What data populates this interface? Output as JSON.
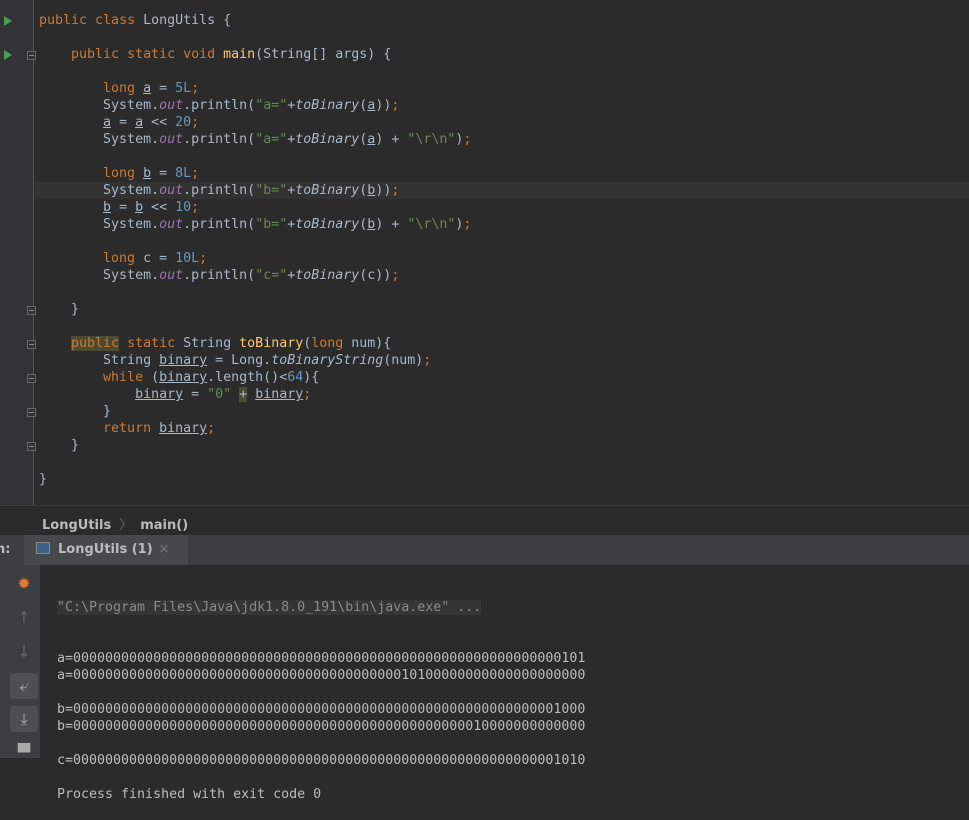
{
  "editor": {
    "current_line": 10,
    "lines": [
      [
        [
          "public ",
          "kw"
        ],
        [
          "class ",
          "kw"
        ],
        [
          "LongUtils {",
          ""
        ]
      ],
      [],
      [
        [
          "    public ",
          "kw"
        ],
        [
          "static ",
          "kw"
        ],
        [
          "void ",
          "kw"
        ],
        [
          "main",
          "fn"
        ],
        [
          "(String[] args) {",
          ""
        ]
      ],
      [],
      [
        [
          "        long ",
          "kw"
        ],
        [
          "a",
          "var"
        ],
        [
          " = ",
          ""
        ],
        [
          "5L",
          "num"
        ],
        [
          ";",
          "kw"
        ]
      ],
      [
        [
          "        System.",
          ""
        ],
        [
          "out",
          "fld"
        ],
        [
          ".println(",
          ""
        ],
        [
          "\"a=\"",
          "str"
        ],
        [
          "+",
          ""
        ],
        [
          "toBinary",
          "sm"
        ],
        [
          "(",
          ""
        ],
        [
          "a",
          "var"
        ],
        [
          "))",
          ""
        ],
        [
          ";",
          "kw"
        ]
      ],
      [
        [
          "        ",
          ""
        ],
        [
          "a",
          "var"
        ],
        [
          " = ",
          ""
        ],
        [
          "a",
          "var"
        ],
        [
          " << ",
          ""
        ],
        [
          "20",
          "num"
        ],
        [
          ";",
          "kw"
        ]
      ],
      [
        [
          "        System.",
          ""
        ],
        [
          "out",
          "fld"
        ],
        [
          ".println(",
          ""
        ],
        [
          "\"a=\"",
          "str"
        ],
        [
          "+",
          ""
        ],
        [
          "toBinary",
          "sm"
        ],
        [
          "(",
          ""
        ],
        [
          "a",
          "var"
        ],
        [
          ") + ",
          ""
        ],
        [
          "\"\\r\\n\"",
          "str"
        ],
        [
          ")",
          ""
        ],
        [
          ";",
          "kw"
        ]
      ],
      [],
      [
        [
          "        long ",
          "kw"
        ],
        [
          "b",
          "var"
        ],
        [
          " = ",
          ""
        ],
        [
          "8L",
          "num"
        ],
        [
          ";",
          "kw"
        ]
      ],
      [
        [
          "        System.",
          ""
        ],
        [
          "out",
          "fld"
        ],
        [
          ".println(",
          ""
        ],
        [
          "\"b=\"",
          "str"
        ],
        [
          "+",
          ""
        ],
        [
          "toBinary",
          "sm"
        ],
        [
          "(",
          ""
        ],
        [
          "b",
          "var"
        ],
        [
          "))",
          ""
        ],
        [
          ";",
          "kw"
        ]
      ],
      [
        [
          "        ",
          ""
        ],
        [
          "b",
          "var"
        ],
        [
          " = ",
          ""
        ],
        [
          "b",
          "var"
        ],
        [
          " << ",
          ""
        ],
        [
          "10",
          "num"
        ],
        [
          ";",
          "kw"
        ]
      ],
      [
        [
          "        System.",
          ""
        ],
        [
          "out",
          "fld"
        ],
        [
          ".println(",
          ""
        ],
        [
          "\"b=\"",
          "str"
        ],
        [
          "+",
          ""
        ],
        [
          "toBinary",
          "sm"
        ],
        [
          "(",
          ""
        ],
        [
          "b",
          "var"
        ],
        [
          ") + ",
          ""
        ],
        [
          "\"\\r\\n\"",
          "str"
        ],
        [
          ")",
          ""
        ],
        [
          ";",
          "kw"
        ]
      ],
      [],
      [
        [
          "        long ",
          "kw"
        ],
        [
          "c = ",
          ""
        ],
        [
          "10L",
          "num"
        ],
        [
          ";",
          "kw"
        ]
      ],
      [
        [
          "        System.",
          ""
        ],
        [
          "out",
          "fld"
        ],
        [
          ".println(",
          ""
        ],
        [
          "\"c=\"",
          "str"
        ],
        [
          "+",
          ""
        ],
        [
          "toBinary",
          "sm"
        ],
        [
          "(c))",
          ""
        ],
        [
          ";",
          "kw"
        ]
      ],
      [],
      [
        [
          "    }",
          ""
        ]
      ],
      [],
      [
        [
          "    ",
          ""
        ],
        [
          "public",
          "kw hl"
        ],
        [
          " static ",
          "kw"
        ],
        [
          "String ",
          ""
        ],
        [
          "toBinary",
          "fn"
        ],
        [
          "(",
          ""
        ],
        [
          "long ",
          "kw"
        ],
        [
          "num){",
          ""
        ]
      ],
      [
        [
          "        String ",
          ""
        ],
        [
          "binary",
          "var"
        ],
        [
          " = Long.",
          ""
        ],
        [
          "toBinaryString",
          "sm"
        ],
        [
          "(num)",
          ""
        ],
        [
          ";",
          "kw"
        ]
      ],
      [
        [
          "        while ",
          "kw"
        ],
        [
          "(",
          ""
        ],
        [
          "binary",
          "var"
        ],
        [
          ".length()<",
          ""
        ],
        [
          "64",
          "num"
        ],
        [
          "){",
          ""
        ]
      ],
      [
        [
          "            ",
          ""
        ],
        [
          "binary",
          "var"
        ],
        [
          " = ",
          ""
        ],
        [
          "\"0\"",
          "str"
        ],
        [
          " ",
          ""
        ],
        [
          "+",
          "hl"
        ],
        [
          " ",
          ""
        ],
        [
          "binary",
          "var"
        ],
        [
          ";",
          "kw"
        ]
      ],
      [
        [
          "        }",
          ""
        ]
      ],
      [
        [
          "        return ",
          "kw"
        ],
        [
          "binary",
          "var"
        ],
        [
          ";",
          "kw"
        ]
      ],
      [
        [
          "    }",
          ""
        ]
      ],
      [],
      [
        [
          "}",
          ""
        ]
      ]
    ]
  },
  "breadcrumb": {
    "items": [
      "LongUtils",
      "main()"
    ],
    "separator": "〉"
  },
  "run_panel": {
    "label": "n:",
    "tab": "LongUtils (1)",
    "close": "×"
  },
  "console": {
    "command": "\"C:\\Program Files\\Java\\jdk1.8.0_191\\bin\\java.exe\" ...",
    "lines": [
      "a=0000000000000000000000000000000000000000000000000000000000000101",
      "a=0000000000000000000000000000000000000000010100000000000000000000",
      "",
      "b=0000000000000000000000000000000000000000000000000000000000001000",
      "b=0000000000000000000000000000000000000000000000000010000000000000",
      "",
      "c=0000000000000000000000000000000000000000000000000000000000001010",
      "",
      "Process finished with exit code 0"
    ]
  },
  "icons": {
    "run": "run-arrow-icon",
    "fold": "fold-icon",
    "debug": "bug-icon",
    "up": "arrow-up-icon",
    "down": "arrow-down-icon",
    "wrap": "soft-wrap-icon",
    "scroll": "scroll-to-end-icon",
    "print": "print-icon"
  }
}
